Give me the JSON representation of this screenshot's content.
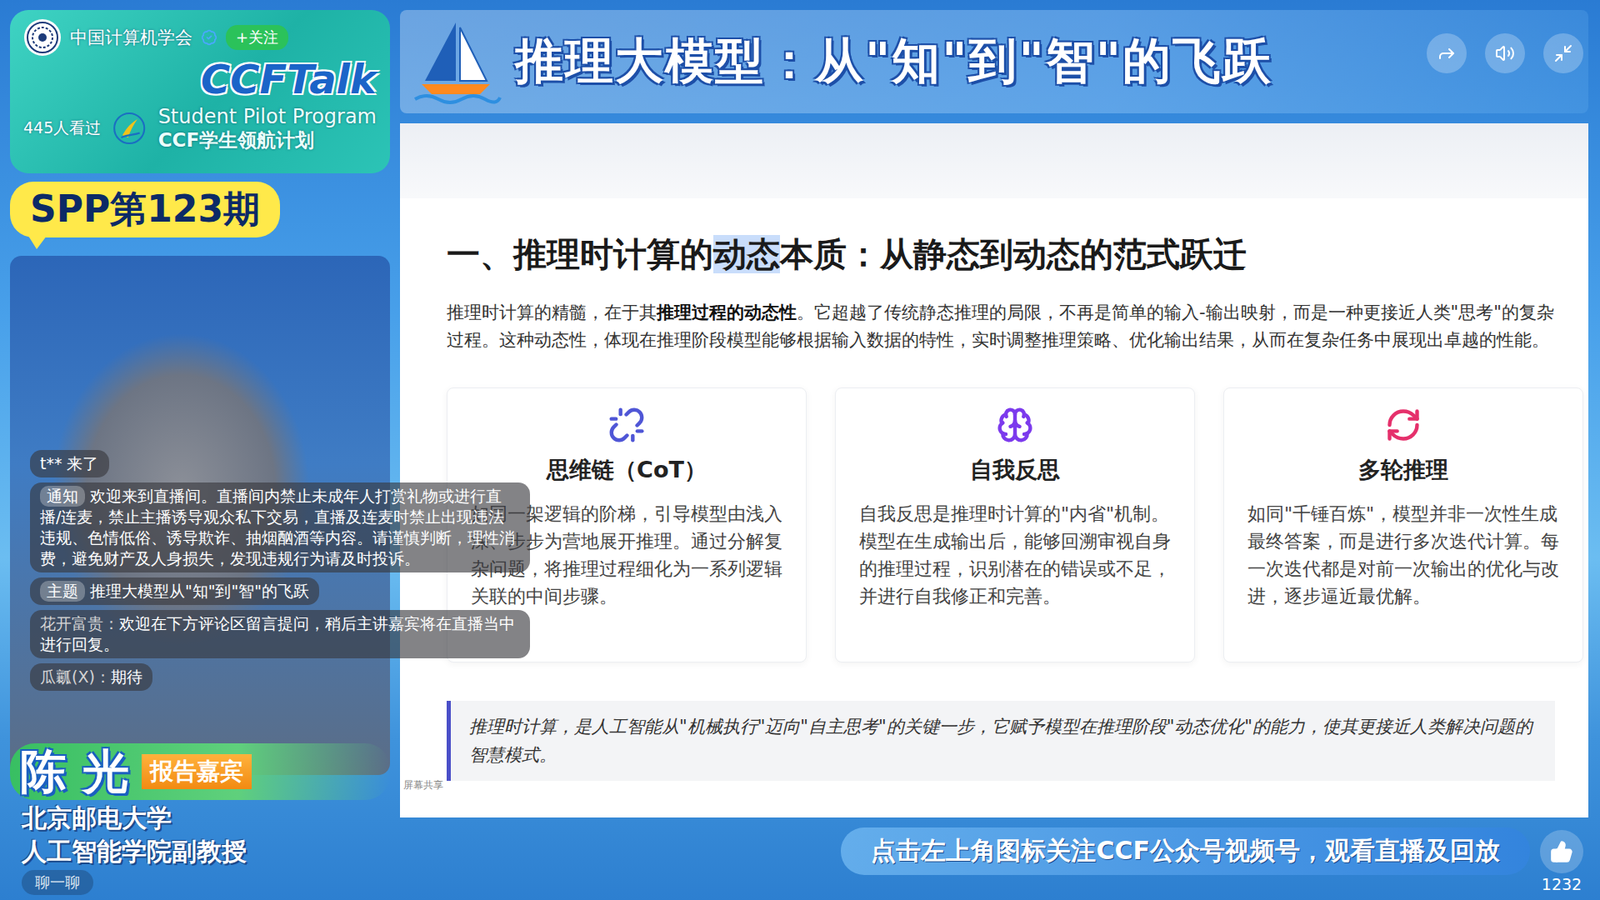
{
  "channel": {
    "name": "中国计算机学会",
    "verified": true,
    "follow": "+关注",
    "views": "445人看过",
    "logo": "CCFTalk",
    "program_en": "Student Pilot Program",
    "program_cn": "CCF学生领航计划"
  },
  "episode": "SPP第123期",
  "title": "推理大模型：从\"知\"到\"智\"的飞跃",
  "chat": {
    "messages": [
      {
        "kind": "join",
        "tag": "",
        "user": "",
        "text": "t** 来了"
      },
      {
        "kind": "notice",
        "tag": "通知",
        "user": "",
        "text": "欢迎来到直播间。直播间内禁止未成年人打赏礼物或进行直播/连麦，禁止主播诱导观众私下交易，直播及连麦时禁止出现违法违规、色情低俗、诱导欺诈、抽烟酗酒等内容。请谨慎判断，理性消费，避免财产及人身损失，发现违规行为请及时投诉。"
      },
      {
        "kind": "notice",
        "tag": "主题",
        "user": "",
        "text": "推理大模型从\"知\"到\"智\"的飞跃"
      },
      {
        "kind": "comment",
        "tag": "",
        "user": "花开富贵：",
        "text": "欢迎在下方评论区留言提问，稍后主讲嘉宾将在直播当中进行回复。"
      },
      {
        "kind": "comment",
        "tag": "",
        "user": "瓜瓤(X)：",
        "text": "期待"
      }
    ],
    "input_placeholder": "聊一聊"
  },
  "speaker": {
    "name": "陈 光",
    "role": "报告嘉宾",
    "affiliation": [
      "北京邮电大学",
      "人工智能学院副教授"
    ]
  },
  "slide": {
    "heading": [
      {
        "text": "一、推理时计算的",
        "highlighted": false
      },
      {
        "text": "动态",
        "highlighted": true
      },
      {
        "text": "本质：从静态到动态的范式跃迁",
        "highlighted": false
      }
    ],
    "intro": [
      {
        "text": "推理时计算的精髓，在于其",
        "bold": false
      },
      {
        "text": "推理过程的动态性",
        "bold": true
      },
      {
        "text": "。它超越了传统静态推理的局限，不再是简单的输入-输出映射，而是一种更接近人类\"思考\"的复杂过程。这种动态性，体现在推理阶段模型能够根据输入数据的特性，实时调整推理策略、优化输出结果，从而在复杂任务中展现出卓越的性能。",
        "bold": false
      }
    ],
    "cards": [
      {
        "title": "思维链（CoT）",
        "body": "如同一架逻辑的阶梯，引导模型由浅入深、步步为营地展开推理。通过分解复杂问题，将推理过程细化为一系列逻辑关联的中间步骤。",
        "color": "#4f56d6"
      },
      {
        "title": "自我反思",
        "body": "自我反思是推理时计算的\"内省\"机制。模型在生成输出后，能够回溯审视自身的推理过程，识别潜在的错误或不足，并进行自我修正和完善。",
        "color": "#7c3aed"
      },
      {
        "title": "多轮推理",
        "body": "如同\"千锤百炼\"，模型并非一次性生成最终答案，而是进行多次迭代计算。每一次迭代都是对前一次输出的优化与改进，逐步逼近最优解。",
        "color": "#e5306b"
      }
    ],
    "quote": "推理时计算，是人工智能从\"机械执行\"迈向\"自主思考\"的关键一步，它赋予模型在推理阶段\"动态优化\"的能力，使其更接近人类解决问题的智慧模式。",
    "share_label": "屏幕共享"
  },
  "footer": {
    "banner": "点击左上角图标关注CCF公众号视频号，观看直播及回放",
    "likes": "1232"
  }
}
